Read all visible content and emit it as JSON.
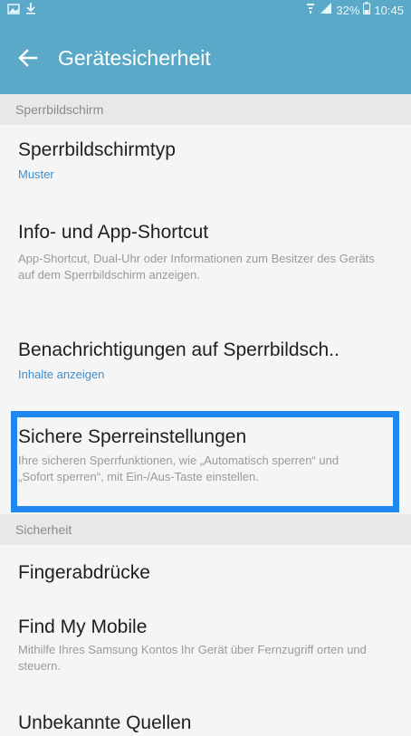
{
  "statusbar": {
    "left_icons": [
      "image-icon",
      "download-icon"
    ],
    "battery": "32%",
    "time": "10:45",
    "right_icons": [
      "wifi-icon",
      "signal-icon",
      "battery-icon"
    ]
  },
  "appbar": {
    "back_icon": "arrow-left-icon",
    "title": "Gerätesicherheit"
  },
  "sections": {
    "sperrbildschirm": "Sperrbildschirm",
    "sicherheit": "Sicherheit"
  },
  "items": {
    "sperrbildschirmtyp": {
      "title": "Sperrbildschirmtyp",
      "subtitle": "Muster"
    },
    "info_app_shortcut": {
      "title": "Info- und App-Shortcut",
      "subtitle": "App-Shortcut, Dual-Uhr oder Informationen zum Besitzer des Geräts auf dem Sperrbildschirm anzeigen."
    },
    "benachrichtigungen": {
      "title": "Benachrichtigungen auf Sperrbildsch..",
      "subtitle": "Inhalte anzeigen"
    },
    "sichere_sperreinstellungen": {
      "title": "Sichere Sperreinstellungen",
      "subtitle": "Ihre sicheren Sperrfunktionen, wie „Automatisch sperren“ und „Sofort sperren“, mit Ein-/Aus-Taste einstellen."
    },
    "fingerabdruecke": {
      "title": "Fingerabdrücke"
    },
    "find_my_mobile": {
      "title": "Find My Mobile",
      "subtitle": "Mithilfe Ihres Samsung Kontos Ihr Gerät über Fernzugriff orten und steuern."
    },
    "unbekannte_quellen": {
      "title": "Unbekannte Quellen"
    }
  },
  "colors": {
    "appbar": "#5aa9c8",
    "accent": "#3e8ecf",
    "highlight": "#1e88f0",
    "background": "#f5f5f5"
  }
}
